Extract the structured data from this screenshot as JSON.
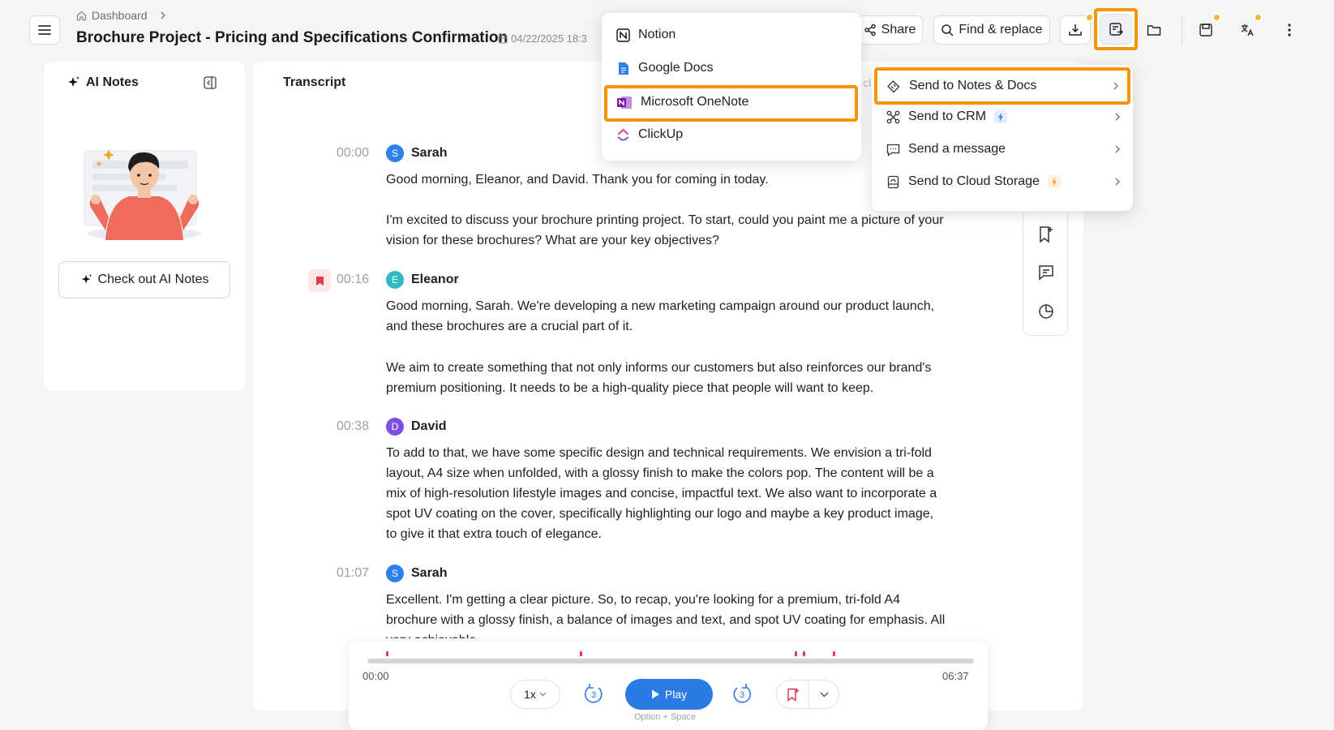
{
  "header": {
    "breadcrumb": "Dashboard",
    "title": "Brochure Project - Pricing and Specifications Confirmation",
    "date": "04/22/2025 18:3",
    "share_label": "Share",
    "find_replace_label": "Find & replace"
  },
  "ai_notes": {
    "title": "AI Notes",
    "button_label": "Check out AI Notes"
  },
  "transcript": {
    "title": "Transcript",
    "hidden_fragment": "cli",
    "segments": [
      {
        "time": "00:00",
        "speaker": "Sarah",
        "initial": "S",
        "color": "#2f80ed",
        "paragraphs": [
          "Good morning, Eleanor, and David. Thank you for coming in today.",
          "I'm excited to discuss your brochure printing project. To start, could you paint me a picture of your vision for these brochures? What are your key objectives?"
        ]
      },
      {
        "time": "00:16",
        "speaker": "Eleanor",
        "initial": "E",
        "color": "#2fb9c6",
        "bookmarked": true,
        "paragraphs": [
          "Good morning, Sarah. We're developing a new marketing campaign around our product launch, and these brochures are a crucial part of it.",
          "We aim to create something that not only informs our customers but also reinforces our brand's premium positioning. It needs to be a high-quality piece that people will want to keep."
        ]
      },
      {
        "time": "00:38",
        "speaker": "David",
        "initial": "D",
        "color": "#7b4fe0",
        "paragraphs": [
          "To add to that, we have some specific design and technical requirements. We envision a tri-fold layout, A4 size when unfolded, with a glossy finish to make the colors pop. The content will be a mix of high-resolution lifestyle images and concise, impactful text. We also want to incorporate a spot UV coating on the cover, specifically highlighting our logo and maybe a key product image, to give it that extra touch of elegance."
        ]
      },
      {
        "time": "01:07",
        "speaker": "Sarah",
        "initial": "S",
        "color": "#2f80ed",
        "paragraphs": [
          "Excellent. I'm getting a clear picture. So, to recap, you're looking for a premium, tri-fold A4 brochure with a glossy finish, a balance of images and text, and spot UV coating for emphasis. All very achievable."
        ]
      }
    ]
  },
  "notes_menu": {
    "items": [
      {
        "label": "Notion",
        "icon": "notion-icon"
      },
      {
        "label": "Google Docs",
        "icon": "google-docs-icon"
      },
      {
        "label": "Microsoft OneNote",
        "icon": "onenote-icon",
        "highlighted": true
      },
      {
        "label": "ClickUp",
        "icon": "clickup-icon"
      }
    ]
  },
  "send_menu": {
    "items": [
      {
        "label": "Send to Notes & Docs",
        "icon": "notes-docs-icon",
        "highlighted": true
      },
      {
        "label": "Send to CRM",
        "icon": "crm-icon",
        "badge": "blue-bolt"
      },
      {
        "label": "Send a message",
        "icon": "message-icon"
      },
      {
        "label": "Send to Cloud Storage",
        "icon": "cloud-storage-icon",
        "badge": "yellow-bolt"
      }
    ]
  },
  "player": {
    "current_time": "00:00",
    "duration": "06:37",
    "progress": 0,
    "speed": "1x",
    "skip_back": "3",
    "skip_forward": "3",
    "play_label": "Play",
    "shortcut_hint": "Option + Space"
  },
  "colors": {
    "accent": "#2c7be5",
    "highlight": "#f7940e",
    "marker": "#e23b4a",
    "badge": "#f7b733"
  }
}
